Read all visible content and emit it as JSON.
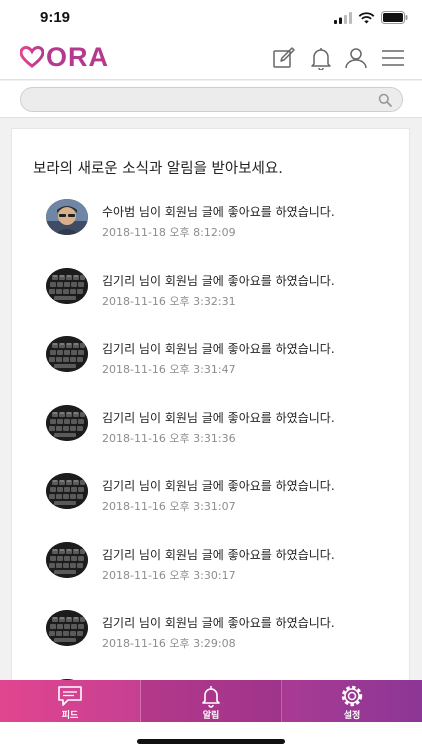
{
  "status_bar": {
    "time": "9:19"
  },
  "header": {
    "logo_text": "ORA",
    "brand_color": "#b43a8f",
    "icons": [
      "compose-icon",
      "bell-icon",
      "user-icon",
      "menu-icon"
    ]
  },
  "search": {
    "value": "",
    "placeholder": ""
  },
  "notifications": {
    "title": "보라의 새로운 소식과 알림을 받아보세요.",
    "items": [
      {
        "avatar": "photo",
        "text": "수아범 님이 회원님 글에 좋아요를 하였습니다.",
        "time": "2018-11-18 오후 8:12:09"
      },
      {
        "avatar": "keyboard",
        "text": "김기리 님이 회원님 글에 좋아요를 하였습니다.",
        "time": "2018-11-16 오후 3:32:31"
      },
      {
        "avatar": "keyboard",
        "text": "김기리 님이 회원님 글에 좋아요를 하였습니다.",
        "time": "2018-11-16 오후 3:31:47"
      },
      {
        "avatar": "keyboard",
        "text": "김기리 님이 회원님 글에 좋아요를 하였습니다.",
        "time": "2018-11-16 오후 3:31:36"
      },
      {
        "avatar": "keyboard",
        "text": "김기리 님이 회원님 글에 좋아요를 하였습니다.",
        "time": "2018-11-16 오후 3:31:07"
      },
      {
        "avatar": "keyboard",
        "text": "김기리 님이 회원님 글에 좋아요를 하였습니다.",
        "time": "2018-11-16 오후 3:30:17"
      },
      {
        "avatar": "keyboard",
        "text": "김기리 님이 회원님 글에 좋아요를 하였습니다.",
        "time": "2018-11-16 오후 3:29:08"
      },
      {
        "avatar": "keyboard",
        "text": "",
        "time": ""
      }
    ]
  },
  "tab_bar": {
    "tabs": [
      {
        "label": "피드",
        "icon": "chat-icon"
      },
      {
        "label": "알림",
        "icon": "bell-icon",
        "active": true
      },
      {
        "label": "설정",
        "icon": "gear-icon"
      }
    ],
    "gradient": [
      "#e1458f",
      "#b83d94",
      "#8c3695"
    ]
  }
}
